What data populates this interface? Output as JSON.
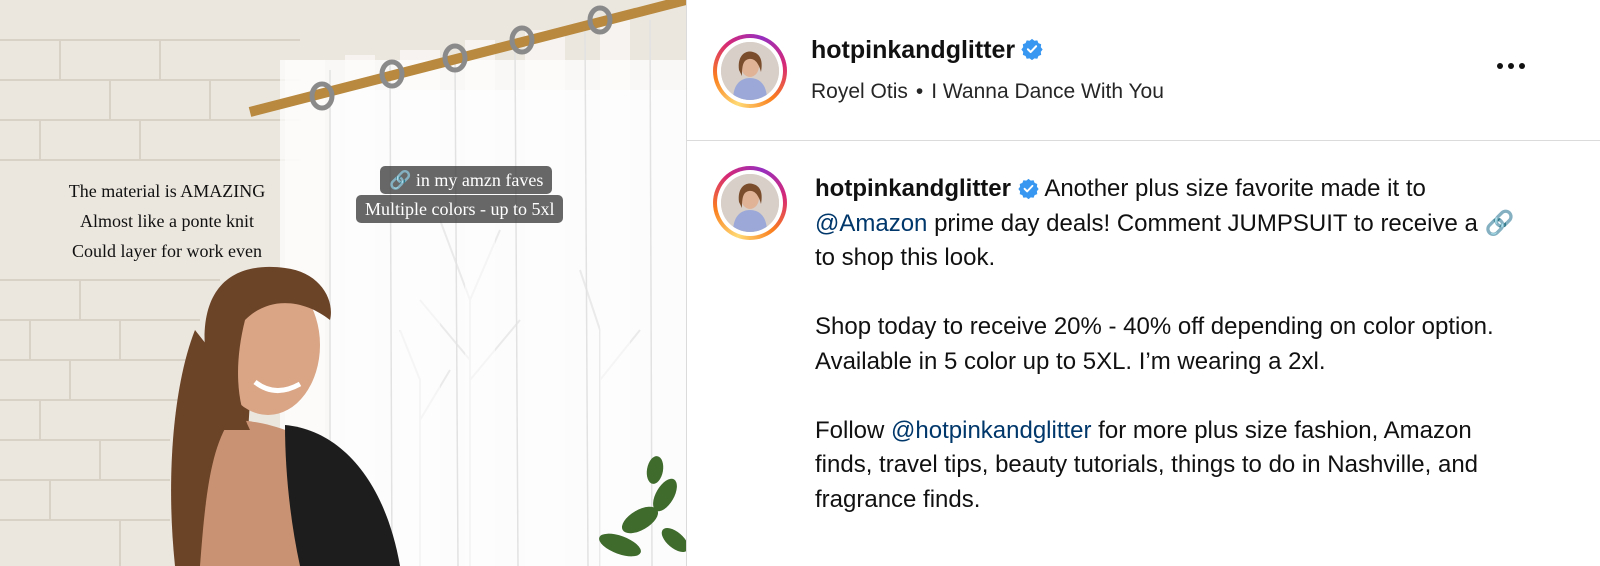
{
  "media": {
    "caption_left": [
      "The material is AMAZING",
      "Almost like a ponte knit",
      "Could layer for work even"
    ],
    "caption_box_1": "🔗 in my amzn faves",
    "caption_box_2": "Multiple colors - up to 5xl"
  },
  "header": {
    "username": "hotpinkandglitter",
    "verified": true,
    "artist": "Royel Otis",
    "separator": "•",
    "song": "I Wanna Dance With You",
    "more_icon": "more-horizontal-icon"
  },
  "post": {
    "username": "hotpinkandglitter",
    "p1_a": " Another plus size favorite made it to ",
    "p1_mention": "@Amazon",
    "p1_b": " prime day deals! Comment JUMPSUIT to receive a 🔗  to shop this look.",
    "p2": "Shop today to receive 20% - 40% off depending on color option. Available in 5 color up to 5XL. I’m wearing a 2xl.",
    "p3_a": "Follow ",
    "p3_mention": "@hotpinkandglitter",
    "p3_b": " for more plus size fashion, Amazon finds, travel tips, beauty tutorials, things to do in Nashville, and fragrance finds."
  },
  "colors": {
    "verified_blue": "#3897f0",
    "mention_blue": "#00376b",
    "border": "#dbdbdb"
  }
}
